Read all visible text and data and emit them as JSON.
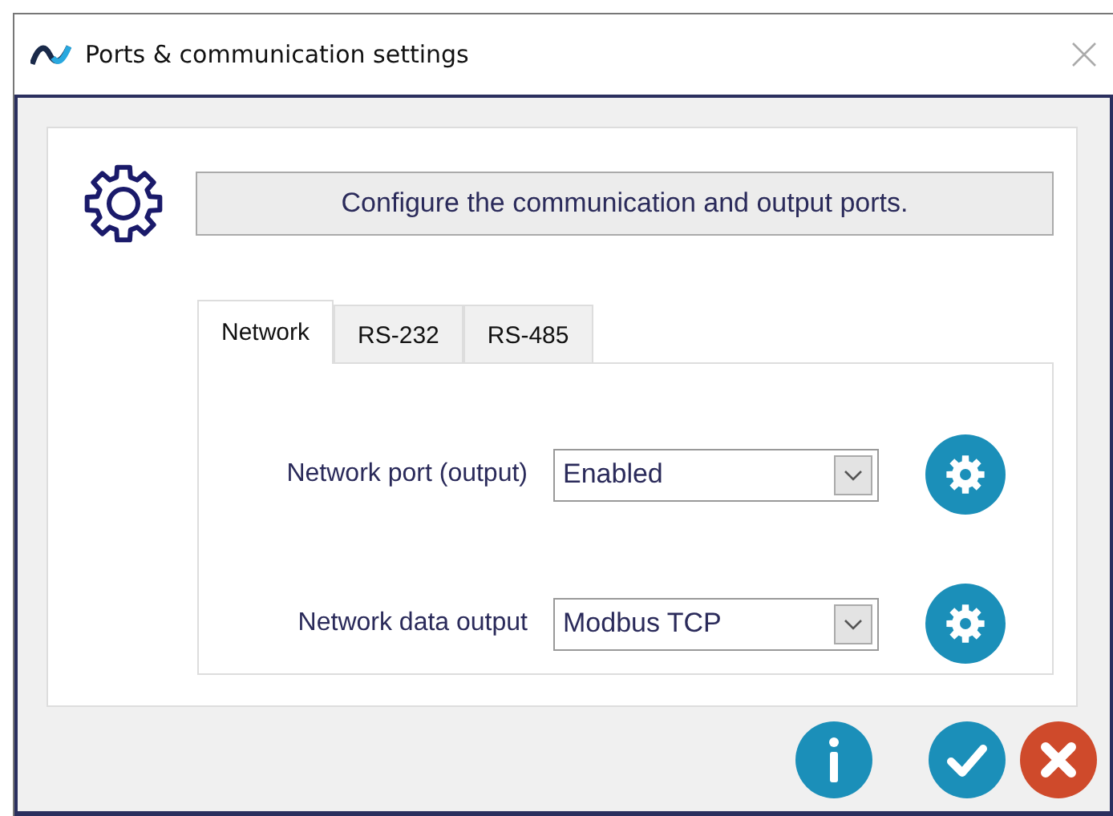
{
  "window": {
    "title": "Ports & communication settings"
  },
  "header": {
    "text": "Configure the communication and output ports."
  },
  "tabs": [
    {
      "label": "Network",
      "selected": true
    },
    {
      "label": "RS-232",
      "selected": false
    },
    {
      "label": "RS-485",
      "selected": false
    }
  ],
  "settings": [
    {
      "label": "Network port (output)",
      "value": "Enabled"
    },
    {
      "label": "Network data output",
      "value": "Modbus TCP"
    }
  ],
  "footer_buttons": [
    {
      "kind": "info"
    },
    {
      "kind": "ok"
    },
    {
      "kind": "cancel"
    }
  ]
}
